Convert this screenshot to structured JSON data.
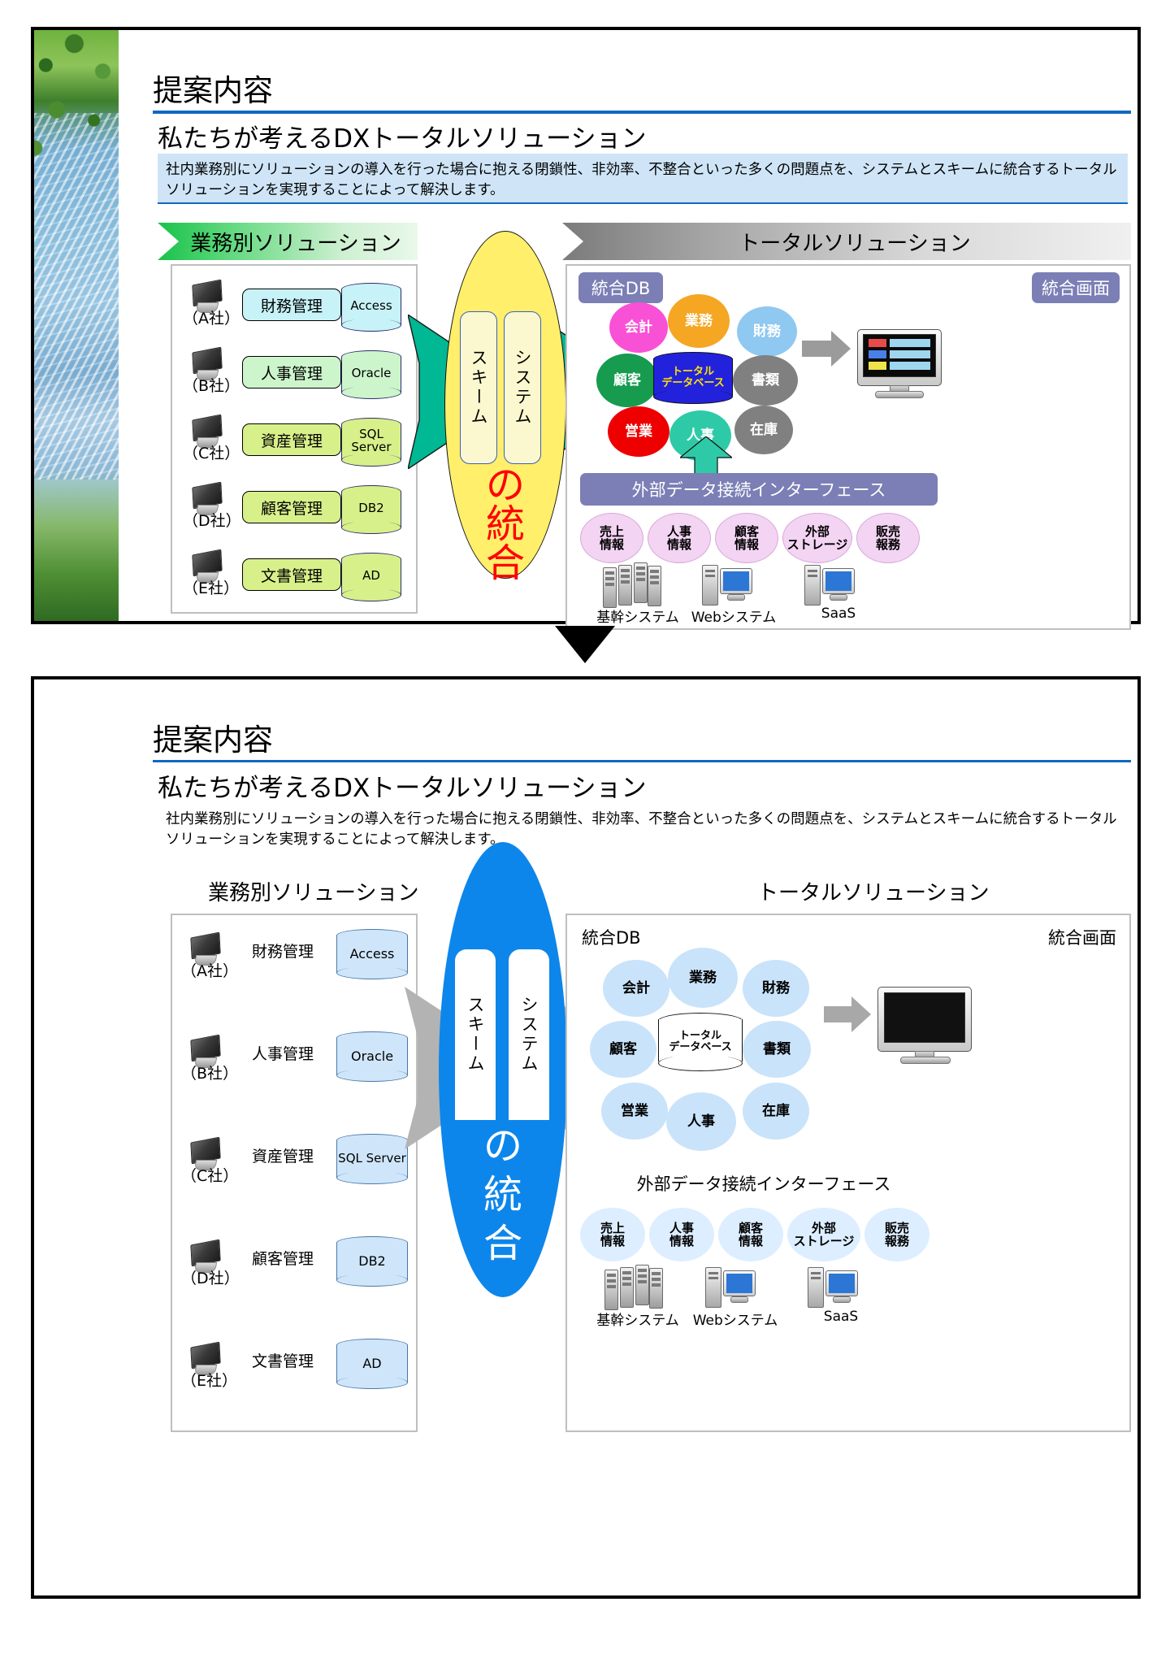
{
  "slide": {
    "title": "提案内容",
    "subtitle": "私たちが考えるDXトータルソリューション",
    "description": "社内業務別にソリューションの導入を行った場合に抱える閉鎖性、非効率、不整合といった多くの問題点を、システムとスキームに統合するトータルソリューションを実現することによって解決します。"
  },
  "left_panel": {
    "banner": "業務別ソリューション",
    "rows": [
      {
        "company": "（A社）",
        "solution": "財務管理",
        "db": "Access",
        "box_color": "#c7f2f7",
        "db_color": "#c7f2f7"
      },
      {
        "company": "（B社）",
        "solution": "人事管理",
        "db": "Oracle",
        "box_color": "#ccf5cc",
        "db_color": "#ccf5cc"
      },
      {
        "company": "（C社）",
        "solution": "資産管理",
        "db": "SQL Server",
        "box_color": "#d8f08a",
        "db_color": "#d8f08a"
      },
      {
        "company": "（D社）",
        "solution": "顧客管理",
        "db": "DB2",
        "box_color": "#d8f08a",
        "db_color": "#d8f08a"
      },
      {
        "company": "（E社）",
        "solution": "文書管理",
        "db": "AD",
        "box_color": "#d8f08a",
        "db_color": "#d8f08a"
      }
    ]
  },
  "center": {
    "pillar_left": "スキーム",
    "pillar_right": "システム",
    "big_line1": "の",
    "big_line2": "統",
    "big_line3": "合",
    "oval_color_top": "#ffef6b",
    "oval_color_bottom": "#0d86eb",
    "big_text_color_top": "#ff0000",
    "big_text_color_bottom": "#ffffff",
    "arrow_color_top": "#00b894",
    "arrow_color_bottom": "#b3b3b3"
  },
  "right_panel": {
    "banner": "トータルソリューション",
    "tag_db": "統合DB",
    "tag_screen": "統合画面",
    "core": {
      "line1": "トータル",
      "line2": "データベース"
    },
    "domains": [
      {
        "label": "会計",
        "color_top": "#f851d6",
        "color_bottom": "#c9e3fa"
      },
      {
        "label": "業務",
        "color_top": "#f5a623",
        "color_bottom": "#c9e3fa"
      },
      {
        "label": "財務",
        "color_top": "#8fc8f0",
        "color_bottom": "#c9e3fa"
      },
      {
        "label": "顧客",
        "color_top": "#169b4f",
        "color_bottom": "#c9e3fa"
      },
      {
        "label": "書類",
        "color_top": "#808080",
        "color_bottom": "#c9e3fa"
      },
      {
        "label": "営業",
        "color_top": "#ee0000",
        "color_bottom": "#c9e3fa"
      },
      {
        "label": "人事",
        "color_top": "#2ecaa8",
        "color_bottom": "#c9e3fa"
      },
      {
        "label": "在庫",
        "color_top": "#808080",
        "color_bottom": "#c9e3fa"
      }
    ],
    "interface_bar": "外部データ接続インターフェース",
    "sources": [
      {
        "line1": "売上",
        "line2": "情報"
      },
      {
        "line1": "人事",
        "line2": "情報"
      },
      {
        "line1": "顧客",
        "line2": "情報"
      },
      {
        "line1": "外部",
        "line2": "ストレージ"
      },
      {
        "line1": "販売",
        "line2": "報務"
      }
    ],
    "systems": [
      {
        "label": "基幹システム",
        "icon": "server-stack-icon"
      },
      {
        "label": "Webシステム",
        "icon": "pc-monitor-icon"
      },
      {
        "label": "SaaS",
        "icon": "pc-monitor-icon"
      }
    ]
  },
  "colors": {
    "accent_rule": "#1068c0",
    "desc_bg": "#cfe5f7",
    "tag_purple": "#7b7fb5",
    "core_top": "#2222dd",
    "core_text_top": "#ffe200"
  }
}
